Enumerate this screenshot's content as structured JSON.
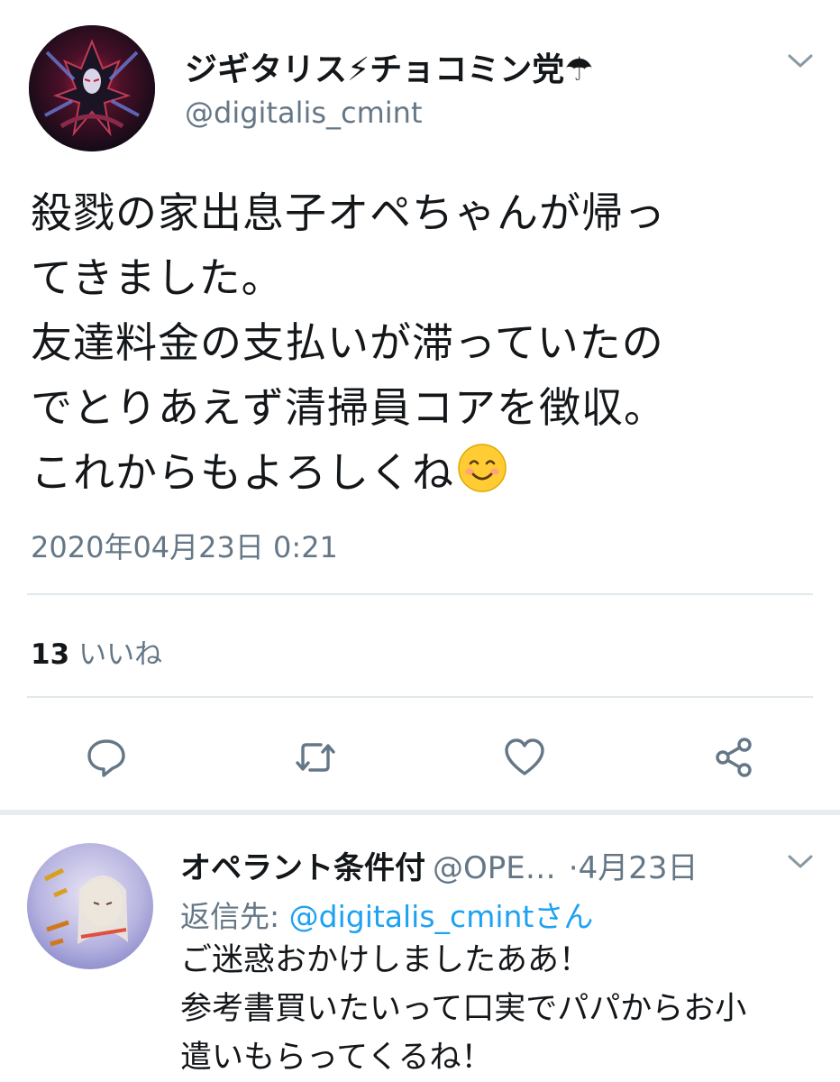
{
  "tweet": {
    "author_name": "ジギタリス⚡チョコミン党☂",
    "author_handle": "@digitalis_cmint",
    "body_lines": [
      "殺戮の家出息子オペちゃんが帰っ",
      "てきました。",
      "友達料金の支払いが滞っていたの",
      "でとりあえず清掃員コアを徴収。",
      "これからもよろしくね"
    ],
    "timestamp": "2020年04月23日 0:21",
    "likes_count": "13",
    "likes_label": "いいね"
  },
  "actions": {
    "reply_icon": "reply-icon",
    "retweet_icon": "retweet-icon",
    "like_icon": "heart-icon",
    "share_icon": "share-icon"
  },
  "reply": {
    "author_name": "オペラント条件付",
    "author_handle": "@OPE…",
    "separator": "·",
    "date": "4月23日",
    "reply_to_prefix": "返信先:",
    "reply_to_mention": "@digitalis_cmintさん",
    "body_lines": [
      "ご迷惑おかけしましたああ！",
      "参考書買いたいって口実でパパからお小",
      "遣いもらってくるね！"
    ]
  },
  "colors": {
    "text_primary": "#14171a",
    "text_secondary": "#657786",
    "link": "#1da1f2",
    "divider": "#e1e8ed"
  }
}
